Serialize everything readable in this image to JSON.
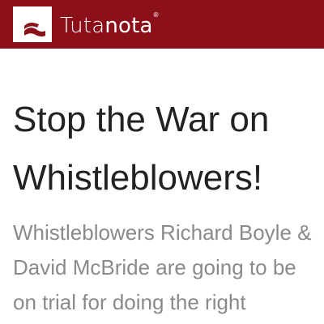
{
  "header": {
    "brand": {
      "name_part1": "Tuta",
      "name_part2": "nota",
      "trademark": "®"
    },
    "colors": {
      "background": "#8b1019",
      "text": "#ffffff"
    }
  },
  "article": {
    "title": "Stop the War on Whistleblowers!",
    "intro": "Whistleblowers Richard Boyle & David McBride are going to be on trial for doing the right"
  }
}
